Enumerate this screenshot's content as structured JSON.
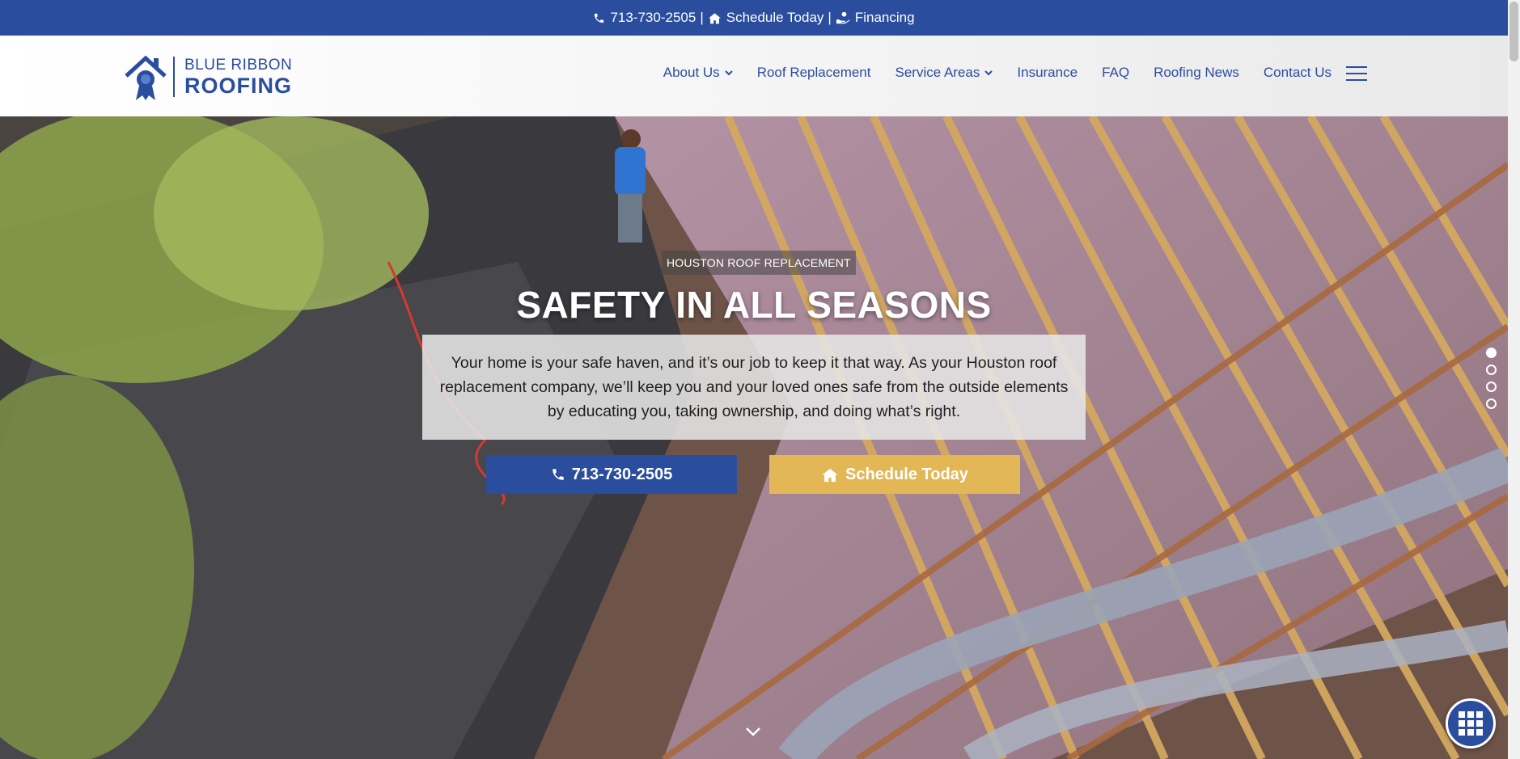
{
  "topbar": {
    "phone": "713-730-2505",
    "schedule": "Schedule Today",
    "financing": "Financing",
    "separator": "|"
  },
  "logo": {
    "line1": "BLUE RIBBON",
    "line2": "ROOFING"
  },
  "nav": {
    "items": [
      {
        "label": "About Us",
        "dropdown": true
      },
      {
        "label": "Roof Replacement",
        "dropdown": false
      },
      {
        "label": "Service Areas",
        "dropdown": true
      },
      {
        "label": "Insurance",
        "dropdown": false
      },
      {
        "label": "FAQ",
        "dropdown": false
      },
      {
        "label": "Roofing News",
        "dropdown": false
      },
      {
        "label": "Contact Us",
        "dropdown": false
      }
    ]
  },
  "hero": {
    "eyebrow": "HOUSTON ROOF REPLACEMENT",
    "headline": "SAFETY IN ALL SEASONS",
    "intro": "Your home is your safe haven, and it’s our job to keep it that way. As your Houston roof replacement company, we’ll keep you and your loved ones safe from the outside elements by educating you, taking ownership, and doing what’s right.",
    "call_button": "713-730-2505",
    "schedule_button": "Schedule Today",
    "slides": 4,
    "active_slide": 1
  },
  "colors": {
    "brand_blue": "#2a4d9e",
    "accent_gold": "#e3b755"
  },
  "icons": {
    "phone": "phone-icon",
    "home": "home-icon",
    "financing": "hand-money-icon",
    "chevron": "chevron-down-icon",
    "menu": "hamburger-menu-icon",
    "apps": "grid-icon"
  }
}
